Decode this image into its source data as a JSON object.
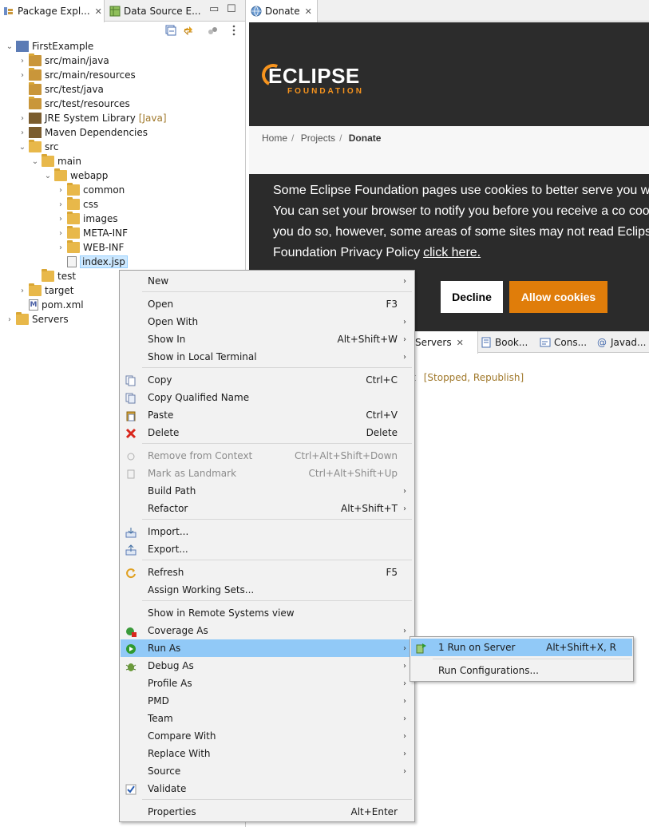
{
  "left_tabs": {
    "package_explorer": "Package Expl...",
    "data_source": "Data Source E..."
  },
  "tree": [
    {
      "label": "FirstExample",
      "icon": "project-icon",
      "deco": "",
      "expanded": "open"
    },
    {
      "label": "src/main/java",
      "icon": "package-folder-icon",
      "deco": "",
      "expanded": "closed"
    },
    {
      "label": "src/main/resources",
      "icon": "package-folder-icon",
      "deco": "",
      "expanded": "closed"
    },
    {
      "label": "src/test/java",
      "icon": "package-folder-icon",
      "deco": "",
      "expanded": ""
    },
    {
      "label": "src/test/resources",
      "icon": "package-folder-icon",
      "deco": "",
      "expanded": ""
    },
    {
      "label": "JRE System Library",
      "icon": "library-icon",
      "deco": "[Java]",
      "expanded": "closed"
    },
    {
      "label": "Maven Dependencies",
      "icon": "library-icon",
      "deco": "",
      "expanded": "closed"
    },
    {
      "label": "src",
      "icon": "folder-icon",
      "deco": "",
      "expanded": "open"
    },
    {
      "label": "main",
      "icon": "folder-icon",
      "deco": "",
      "expanded": "open"
    },
    {
      "label": "webapp",
      "icon": "folder-icon",
      "deco": "",
      "expanded": "open"
    },
    {
      "label": "common",
      "icon": "folder-icon",
      "deco": "",
      "expanded": "closed"
    },
    {
      "label": "css",
      "icon": "folder-icon",
      "deco": "",
      "expanded": "closed"
    },
    {
      "label": "images",
      "icon": "folder-icon",
      "deco": "",
      "expanded": "closed"
    },
    {
      "label": "META-INF",
      "icon": "folder-icon",
      "deco": "",
      "expanded": "closed"
    },
    {
      "label": "WEB-INF",
      "icon": "folder-icon",
      "deco": "",
      "expanded": "closed"
    },
    {
      "label": "index.jsp",
      "icon": "jsp-file-icon",
      "deco": "",
      "expanded": ""
    },
    {
      "label": "test",
      "icon": "folder-icon",
      "deco": "",
      "expanded": ""
    },
    {
      "label": "target",
      "icon": "folder-icon",
      "deco": "",
      "expanded": "closed"
    },
    {
      "label": "pom.xml",
      "icon": "xml-file-icon",
      "deco": "",
      "expanded": ""
    },
    {
      "label": "Servers",
      "icon": "folder-icon",
      "deco": "",
      "expanded": "closed"
    }
  ],
  "editor": {
    "tab_label": "Donate",
    "logo_word": "ECLIPSE",
    "logo_sub": "FOUNDATION",
    "breadcrumb": [
      "Home",
      "Projects",
      "Donate"
    ],
    "cookie_text": "Some Eclipse Foundation pages use cookies to better serve you w site. You can set your browser to notify you before you receive a co cookies. If you do so, however, some areas of some sites may not read Eclipse Foundation Privacy Policy",
    "cookie_link": "click here.",
    "decline": "Decline",
    "allow": "Allow cookies"
  },
  "bottom_tabs": {
    "servers": "Servers",
    "bookmarks": "Book...",
    "console": "Cons...",
    "javadoc": "Javad..."
  },
  "server_row": {
    "name_tail": "t",
    "status": "[Stopped, Republish]"
  },
  "context_menu": [
    {
      "label": "New",
      "key": "",
      "arrow": true,
      "icon": "",
      "disabled": false
    },
    {
      "label": "Open",
      "key": "F3",
      "arrow": false,
      "icon": "",
      "disabled": false
    },
    {
      "label": "Open With",
      "key": "",
      "arrow": true,
      "icon": "",
      "disabled": false
    },
    {
      "label": "Show In",
      "key": "Alt+Shift+W",
      "arrow": true,
      "icon": "",
      "disabled": false
    },
    {
      "label": "Show in Local Terminal",
      "key": "",
      "arrow": true,
      "icon": "",
      "disabled": false
    },
    {
      "label": "Copy",
      "key": "Ctrl+C",
      "arrow": false,
      "icon": "copy-icon",
      "disabled": false
    },
    {
      "label": "Copy Qualified Name",
      "key": "",
      "arrow": false,
      "icon": "copy-qualified-icon",
      "disabled": false
    },
    {
      "label": "Paste",
      "key": "Ctrl+V",
      "arrow": false,
      "icon": "paste-icon",
      "disabled": false
    },
    {
      "label": "Delete",
      "key": "Delete",
      "arrow": false,
      "icon": "delete-icon",
      "disabled": false
    },
    {
      "label": "Remove from Context",
      "key": "Ctrl+Alt+Shift+Down",
      "arrow": false,
      "icon": "remove-context-icon",
      "disabled": true
    },
    {
      "label": "Mark as Landmark",
      "key": "Ctrl+Alt+Shift+Up",
      "arrow": false,
      "icon": "landmark-icon",
      "disabled": true
    },
    {
      "label": "Build Path",
      "key": "",
      "arrow": true,
      "icon": "",
      "disabled": false
    },
    {
      "label": "Refactor",
      "key": "Alt+Shift+T",
      "arrow": true,
      "icon": "",
      "disabled": false
    },
    {
      "label": "Import...",
      "key": "",
      "arrow": false,
      "icon": "import-icon",
      "disabled": false
    },
    {
      "label": "Export...",
      "key": "",
      "arrow": false,
      "icon": "export-icon",
      "disabled": false
    },
    {
      "label": "Refresh",
      "key": "F5",
      "arrow": false,
      "icon": "refresh-icon",
      "disabled": false
    },
    {
      "label": "Assign Working Sets...",
      "key": "",
      "arrow": false,
      "icon": "",
      "disabled": false
    },
    {
      "label": "Show in Remote Systems view",
      "key": "",
      "arrow": false,
      "icon": "",
      "disabled": false
    },
    {
      "label": "Coverage As",
      "key": "",
      "arrow": true,
      "icon": "coverage-icon",
      "disabled": false
    },
    {
      "label": "Run As",
      "key": "",
      "arrow": true,
      "icon": "run-icon",
      "disabled": false,
      "highlighted": true
    },
    {
      "label": "Debug As",
      "key": "",
      "arrow": true,
      "icon": "debug-icon",
      "disabled": false
    },
    {
      "label": "Profile As",
      "key": "",
      "arrow": true,
      "icon": "",
      "disabled": false
    },
    {
      "label": "PMD",
      "key": "",
      "arrow": true,
      "icon": "",
      "disabled": false
    },
    {
      "label": "Team",
      "key": "",
      "arrow": true,
      "icon": "",
      "disabled": false
    },
    {
      "label": "Compare With",
      "key": "",
      "arrow": true,
      "icon": "",
      "disabled": false
    },
    {
      "label": "Replace With",
      "key": "",
      "arrow": true,
      "icon": "",
      "disabled": false
    },
    {
      "label": "Source",
      "key": "",
      "arrow": true,
      "icon": "",
      "disabled": false
    },
    {
      "label": "Validate",
      "key": "",
      "arrow": false,
      "icon": "check-icon",
      "disabled": false
    },
    {
      "label": "Properties",
      "key": "Alt+Enter",
      "arrow": false,
      "icon": "",
      "disabled": false
    }
  ],
  "submenu": [
    {
      "label": "1 Run on Server",
      "key": "Alt+Shift+X, R",
      "icon": "run-on-server-icon",
      "highlighted": true
    },
    {
      "label": "Run Configurations...",
      "key": "",
      "icon": "",
      "highlighted": false
    }
  ],
  "colors": {
    "menu_highlight": "#91c9f7",
    "eclipse_orange": "#e07d0a",
    "tree_selection": "#cce8ff",
    "decoration": "#a0782a"
  }
}
